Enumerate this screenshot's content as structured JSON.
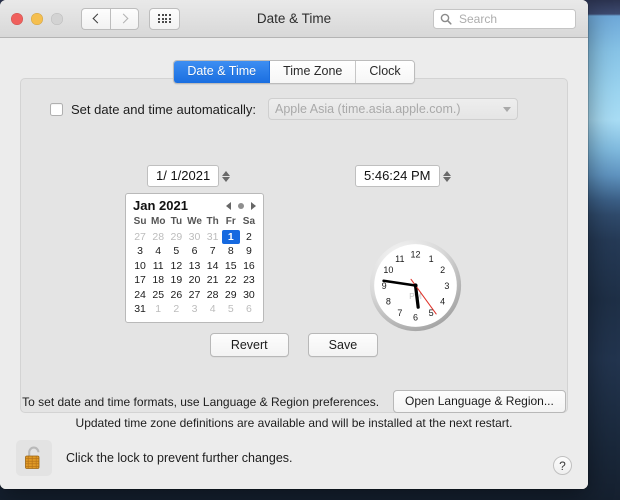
{
  "window": {
    "title": "Date & Time",
    "traffic_lights": [
      "close",
      "minimize",
      "zoom"
    ],
    "nav_back": "back-arrow",
    "nav_forward": "forward-arrow",
    "show_all": "grid-icon"
  },
  "search": {
    "placeholder": "Search",
    "value": "",
    "icon": "search-icon"
  },
  "tabs": [
    {
      "label": "Date & Time",
      "active": true
    },
    {
      "label": "Time Zone",
      "active": false
    },
    {
      "label": "Clock",
      "active": false
    }
  ],
  "auto": {
    "checkbox_checked": false,
    "label": "Set date and time automatically:",
    "server_value": "Apple Asia (time.asia.apple.com.)",
    "server_enabled": false,
    "dropdown_icon": "chevron-down-icon"
  },
  "date_field": {
    "value": "1/  1/2021",
    "stepper": "stepper-arrows"
  },
  "time_field": {
    "value": "5:46:24 PM",
    "stepper": "stepper-arrows"
  },
  "calendar": {
    "month_label": "Jan 2021",
    "prev_icon": "triangle-left-icon",
    "today_icon": "dot-icon",
    "next_icon": "triangle-right-icon",
    "day_headers": [
      "Su",
      "Mo",
      "Tu",
      "We",
      "Th",
      "Fr",
      "Sa"
    ],
    "selected_day": 1,
    "weeks": [
      [
        {
          "d": 27,
          "o": true
        },
        {
          "d": 28,
          "o": true
        },
        {
          "d": 29,
          "o": true
        },
        {
          "d": 30,
          "o": true
        },
        {
          "d": 31,
          "o": true
        },
        {
          "d": 1,
          "o": false,
          "sel": true
        },
        {
          "d": 2,
          "o": false
        }
      ],
      [
        {
          "d": 3,
          "o": false
        },
        {
          "d": 4,
          "o": false
        },
        {
          "d": 5,
          "o": false
        },
        {
          "d": 6,
          "o": false
        },
        {
          "d": 7,
          "o": false
        },
        {
          "d": 8,
          "o": false
        },
        {
          "d": 9,
          "o": false
        }
      ],
      [
        {
          "d": 10,
          "o": false
        },
        {
          "d": 11,
          "o": false
        },
        {
          "d": 12,
          "o": false
        },
        {
          "d": 13,
          "o": false
        },
        {
          "d": 14,
          "o": false
        },
        {
          "d": 15,
          "o": false
        },
        {
          "d": 16,
          "o": false
        }
      ],
      [
        {
          "d": 17,
          "o": false
        },
        {
          "d": 18,
          "o": false
        },
        {
          "d": 19,
          "o": false
        },
        {
          "d": 20,
          "o": false
        },
        {
          "d": 21,
          "o": false
        },
        {
          "d": 22,
          "o": false
        },
        {
          "d": 23,
          "o": false
        }
      ],
      [
        {
          "d": 24,
          "o": false
        },
        {
          "d": 25,
          "o": false
        },
        {
          "d": 26,
          "o": false
        },
        {
          "d": 27,
          "o": false
        },
        {
          "d": 28,
          "o": false
        },
        {
          "d": 29,
          "o": false
        },
        {
          "d": 30,
          "o": false
        }
      ],
      [
        {
          "d": 31,
          "o": false
        },
        {
          "d": 1,
          "o": true
        },
        {
          "d": 2,
          "o": true
        },
        {
          "d": 3,
          "o": true
        },
        {
          "d": 4,
          "o": true
        },
        {
          "d": 5,
          "o": true
        },
        {
          "d": 6,
          "o": true
        }
      ]
    ]
  },
  "clock": {
    "numerals": [
      "12",
      "1",
      "2",
      "3",
      "4",
      "5",
      "6",
      "7",
      "8",
      "9",
      "10",
      "11"
    ],
    "meridiem": "PM",
    "hour": 5,
    "minute": 46,
    "second": 24,
    "second_hand_color": "#e0342b"
  },
  "buttons": {
    "revert": "Revert",
    "save": "Save"
  },
  "notes": {
    "formats_text": "To set date and time formats, use Language & Region preferences.",
    "open_language_region": "Open Language & Region...",
    "timezone_update": "Updated time zone definitions are available and will be installed at the next restart."
  },
  "lock": {
    "icon": "unlocked-padlock-icon",
    "text": "Click the lock to prevent further changes."
  },
  "help": {
    "label": "?"
  },
  "colors": {
    "accent": "#1a6ee0",
    "selected_day": "#1569e0",
    "second_hand": "#e0342b",
    "window_bg": "#ececec",
    "panel_bg": "#e4e4e4"
  }
}
